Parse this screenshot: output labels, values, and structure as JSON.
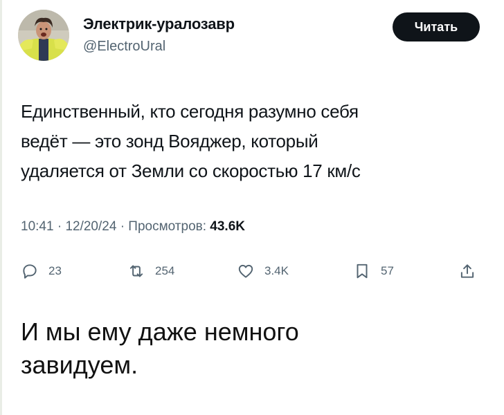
{
  "author": {
    "display_name": "Электрик-уралозавр",
    "handle": "@ElectroUral",
    "follow_label": "Читать"
  },
  "tweet": {
    "lines": [
      "Единственный, кто сегодня разумно себя",
      "ведёт — это зонд Вояджер, который",
      "удаляется от Земли со скоростью 17 км/с"
    ],
    "time": "10:41",
    "date": "12/20/24",
    "views_label": "Просмотров:",
    "views_count": "43.6K"
  },
  "actions": {
    "replies": "23",
    "reposts": "254",
    "likes": "3.4K",
    "bookmarks": "57"
  },
  "icons": {
    "reply": "reply-icon",
    "repost": "repost-icon",
    "like": "heart-icon",
    "bookmark": "bookmark-icon",
    "share": "share-icon"
  },
  "caption": {
    "lines": [
      "И мы ему даже немного",
      "завидуем."
    ]
  },
  "colors": {
    "text": "#0f1419",
    "secondary": "#536471",
    "button_bg": "#0f1419",
    "button_text": "#ffffff"
  }
}
